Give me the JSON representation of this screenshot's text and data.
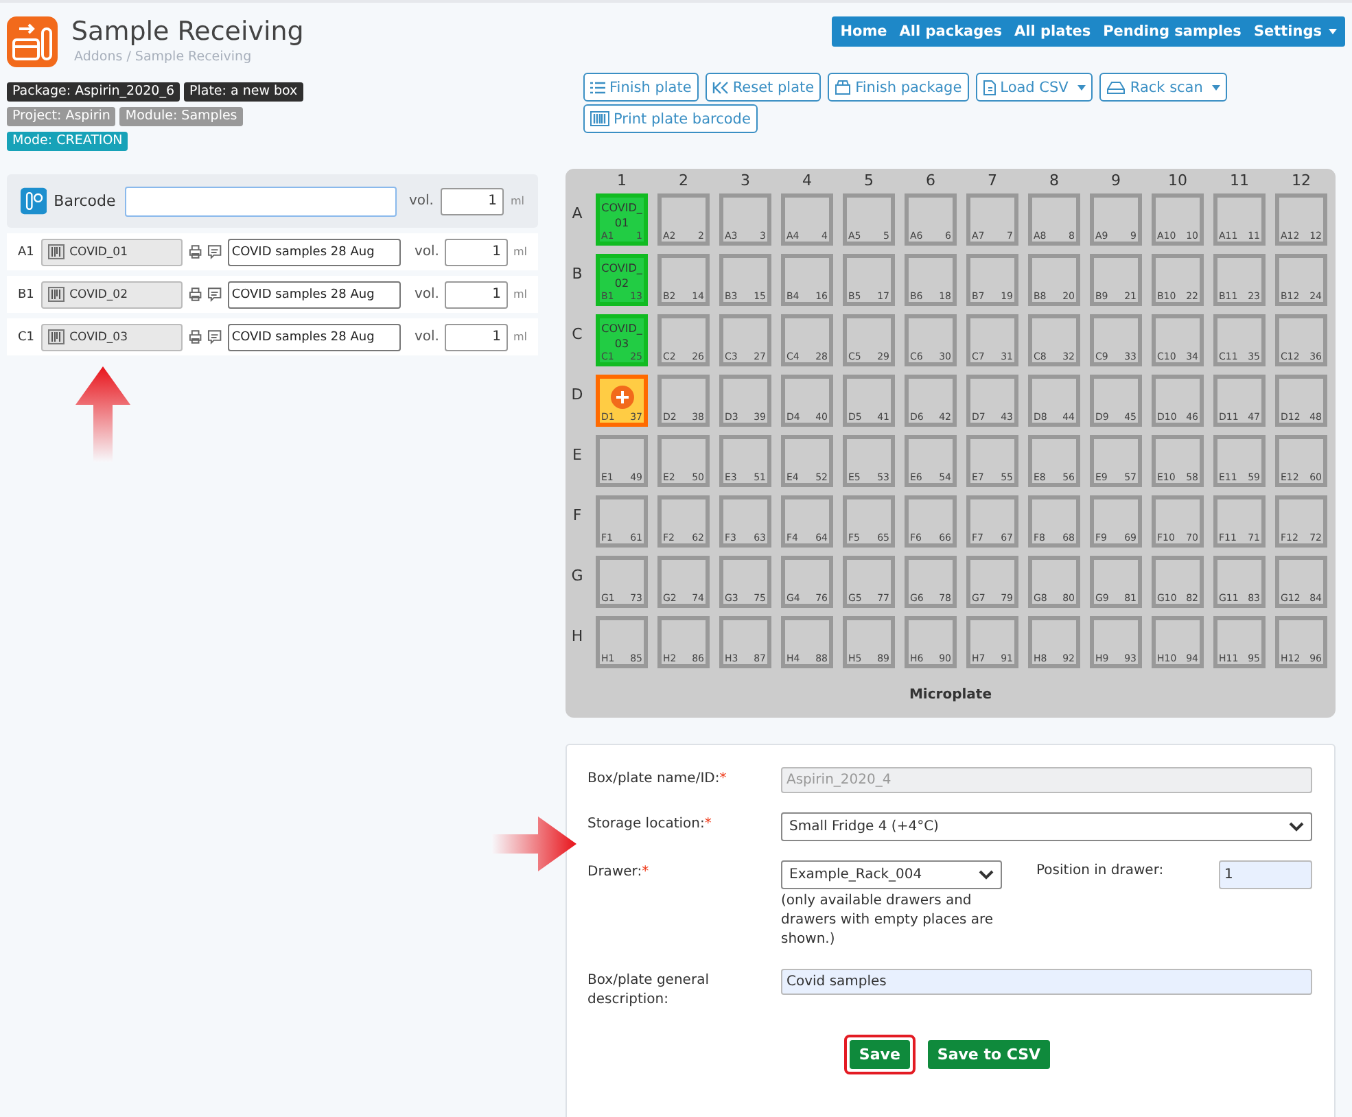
{
  "header": {
    "title": "Sample Receiving",
    "breadcrumb": "Addons / Sample Receiving"
  },
  "nav": [
    {
      "label": "Home",
      "dropdown": false
    },
    {
      "label": "All packages",
      "dropdown": false
    },
    {
      "label": "All plates",
      "dropdown": false
    },
    {
      "label": "Pending samples",
      "dropdown": false
    },
    {
      "label": "Settings",
      "dropdown": true
    }
  ],
  "badges": [
    [
      {
        "text": "Package: Aspirin_2020_6",
        "kind": "dark"
      },
      {
        "text": "Plate: a new box",
        "kind": "dark"
      }
    ],
    [
      {
        "text": "Project: Aspirin",
        "kind": "grey"
      },
      {
        "text": "Module: Samples",
        "kind": "grey"
      }
    ],
    [
      {
        "text": "Mode: CREATION",
        "kind": "info"
      }
    ]
  ],
  "toolbar": [
    [
      {
        "label": "Finish plate",
        "kind": "list",
        "dropdown": false
      },
      {
        "label": "Reset plate",
        "kind": "rewind",
        "dropdown": false
      },
      {
        "label": "Finish package",
        "kind": "box",
        "dropdown": false
      },
      {
        "label": "Load CSV",
        "kind": "file",
        "dropdown": true
      },
      {
        "label": "Rack scan",
        "kind": "scanner",
        "dropdown": true
      }
    ],
    [
      {
        "label": "Print plate barcode",
        "kind": "barcode",
        "dropdown": false
      }
    ]
  ],
  "barcode_entry": {
    "label": "Barcode",
    "vol_label": "vol.",
    "volume": "1",
    "unit": "ml"
  },
  "samples": [
    {
      "position": "A1",
      "barcode": "COVID_01",
      "description": "COVID samples 28 Aug",
      "vol_label": "vol.",
      "volume": "1",
      "unit": "ml"
    },
    {
      "position": "B1",
      "barcode": "COVID_02",
      "description": "COVID samples 28 Aug",
      "vol_label": "vol.",
      "volume": "1",
      "unit": "ml"
    },
    {
      "position": "C1",
      "barcode": "COVID_03",
      "description": "COVID samples 28 Aug",
      "vol_label": "vol.",
      "volume": "1",
      "unit": "ml"
    }
  ],
  "plate": {
    "title": "Microplate",
    "columns": [
      "1",
      "2",
      "3",
      "4",
      "5",
      "6",
      "7",
      "8",
      "9",
      "10",
      "11",
      "12"
    ],
    "rows": [
      {
        "label": "A",
        "wells": [
          {
            "label": "A1",
            "number": "1",
            "kind": "filled",
            "content": "COVID_01"
          },
          {
            "label": "A2",
            "number": "2",
            "kind": "empty"
          },
          {
            "label": "A3",
            "number": "3",
            "kind": "empty"
          },
          {
            "label": "A4",
            "number": "4",
            "kind": "empty"
          },
          {
            "label": "A5",
            "number": "5",
            "kind": "empty"
          },
          {
            "label": "A6",
            "number": "6",
            "kind": "empty"
          },
          {
            "label": "A7",
            "number": "7",
            "kind": "empty"
          },
          {
            "label": "A8",
            "number": "8",
            "kind": "empty"
          },
          {
            "label": "A9",
            "number": "9",
            "kind": "empty"
          },
          {
            "label": "A10",
            "number": "10",
            "kind": "empty"
          },
          {
            "label": "A11",
            "number": "11",
            "kind": "empty"
          },
          {
            "label": "A12",
            "number": "12",
            "kind": "empty"
          }
        ]
      },
      {
        "label": "B",
        "wells": [
          {
            "label": "B1",
            "number": "13",
            "kind": "filled",
            "content": "COVID_02"
          },
          {
            "label": "B2",
            "number": "14",
            "kind": "empty"
          },
          {
            "label": "B3",
            "number": "15",
            "kind": "empty"
          },
          {
            "label": "B4",
            "number": "16",
            "kind": "empty"
          },
          {
            "label": "B5",
            "number": "17",
            "kind": "empty"
          },
          {
            "label": "B6",
            "number": "18",
            "kind": "empty"
          },
          {
            "label": "B7",
            "number": "19",
            "kind": "empty"
          },
          {
            "label": "B8",
            "number": "20",
            "kind": "empty"
          },
          {
            "label": "B9",
            "number": "21",
            "kind": "empty"
          },
          {
            "label": "B10",
            "number": "22",
            "kind": "empty"
          },
          {
            "label": "B11",
            "number": "23",
            "kind": "empty"
          },
          {
            "label": "B12",
            "number": "24",
            "kind": "empty"
          }
        ]
      },
      {
        "label": "C",
        "wells": [
          {
            "label": "C1",
            "number": "25",
            "kind": "filled",
            "content": "COVID_03"
          },
          {
            "label": "C2",
            "number": "26",
            "kind": "empty"
          },
          {
            "label": "C3",
            "number": "27",
            "kind": "empty"
          },
          {
            "label": "C4",
            "number": "28",
            "kind": "empty"
          },
          {
            "label": "C5",
            "number": "29",
            "kind": "empty"
          },
          {
            "label": "C6",
            "number": "30",
            "kind": "empty"
          },
          {
            "label": "C7",
            "number": "31",
            "kind": "empty"
          },
          {
            "label": "C8",
            "number": "32",
            "kind": "empty"
          },
          {
            "label": "C9",
            "number": "33",
            "kind": "empty"
          },
          {
            "label": "C10",
            "number": "34",
            "kind": "empty"
          },
          {
            "label": "C11",
            "number": "35",
            "kind": "empty"
          },
          {
            "label": "C12",
            "number": "36",
            "kind": "empty"
          }
        ]
      },
      {
        "label": "D",
        "wells": [
          {
            "label": "D1",
            "number": "37",
            "kind": "current"
          },
          {
            "label": "D2",
            "number": "38",
            "kind": "empty"
          },
          {
            "label": "D3",
            "number": "39",
            "kind": "empty"
          },
          {
            "label": "D4",
            "number": "40",
            "kind": "empty"
          },
          {
            "label": "D5",
            "number": "41",
            "kind": "empty"
          },
          {
            "label": "D6",
            "number": "42",
            "kind": "empty"
          },
          {
            "label": "D7",
            "number": "43",
            "kind": "empty"
          },
          {
            "label": "D8",
            "number": "44",
            "kind": "empty"
          },
          {
            "label": "D9",
            "number": "45",
            "kind": "empty"
          },
          {
            "label": "D10",
            "number": "46",
            "kind": "empty"
          },
          {
            "label": "D11",
            "number": "47",
            "kind": "empty"
          },
          {
            "label": "D12",
            "number": "48",
            "kind": "empty"
          }
        ]
      },
      {
        "label": "E",
        "wells": [
          {
            "label": "E1",
            "number": "49",
            "kind": "empty"
          },
          {
            "label": "E2",
            "number": "50",
            "kind": "empty"
          },
          {
            "label": "E3",
            "number": "51",
            "kind": "empty"
          },
          {
            "label": "E4",
            "number": "52",
            "kind": "empty"
          },
          {
            "label": "E5",
            "number": "53",
            "kind": "empty"
          },
          {
            "label": "E6",
            "number": "54",
            "kind": "empty"
          },
          {
            "label": "E7",
            "number": "55",
            "kind": "empty"
          },
          {
            "label": "E8",
            "number": "56",
            "kind": "empty"
          },
          {
            "label": "E9",
            "number": "57",
            "kind": "empty"
          },
          {
            "label": "E10",
            "number": "58",
            "kind": "empty"
          },
          {
            "label": "E11",
            "number": "59",
            "kind": "empty"
          },
          {
            "label": "E12",
            "number": "60",
            "kind": "empty"
          }
        ]
      },
      {
        "label": "F",
        "wells": [
          {
            "label": "F1",
            "number": "61",
            "kind": "empty"
          },
          {
            "label": "F2",
            "number": "62",
            "kind": "empty"
          },
          {
            "label": "F3",
            "number": "63",
            "kind": "empty"
          },
          {
            "label": "F4",
            "number": "64",
            "kind": "empty"
          },
          {
            "label": "F5",
            "number": "65",
            "kind": "empty"
          },
          {
            "label": "F6",
            "number": "66",
            "kind": "empty"
          },
          {
            "label": "F7",
            "number": "67",
            "kind": "empty"
          },
          {
            "label": "F8",
            "number": "68",
            "kind": "empty"
          },
          {
            "label": "F9",
            "number": "69",
            "kind": "empty"
          },
          {
            "label": "F10",
            "number": "70",
            "kind": "empty"
          },
          {
            "label": "F11",
            "number": "71",
            "kind": "empty"
          },
          {
            "label": "F12",
            "number": "72",
            "kind": "empty"
          }
        ]
      },
      {
        "label": "G",
        "wells": [
          {
            "label": "G1",
            "number": "73",
            "kind": "empty"
          },
          {
            "label": "G2",
            "number": "74",
            "kind": "empty"
          },
          {
            "label": "G3",
            "number": "75",
            "kind": "empty"
          },
          {
            "label": "G4",
            "number": "76",
            "kind": "empty"
          },
          {
            "label": "G5",
            "number": "77",
            "kind": "empty"
          },
          {
            "label": "G6",
            "number": "78",
            "kind": "empty"
          },
          {
            "label": "G7",
            "number": "79",
            "kind": "empty"
          },
          {
            "label": "G8",
            "number": "80",
            "kind": "empty"
          },
          {
            "label": "G9",
            "number": "81",
            "kind": "empty"
          },
          {
            "label": "G10",
            "number": "82",
            "kind": "empty"
          },
          {
            "label": "G11",
            "number": "83",
            "kind": "empty"
          },
          {
            "label": "G12",
            "number": "84",
            "kind": "empty"
          }
        ]
      },
      {
        "label": "H",
        "wells": [
          {
            "label": "H1",
            "number": "85",
            "kind": "empty"
          },
          {
            "label": "H2",
            "number": "86",
            "kind": "empty"
          },
          {
            "label": "H3",
            "number": "87",
            "kind": "empty"
          },
          {
            "label": "H4",
            "number": "88",
            "kind": "empty"
          },
          {
            "label": "H5",
            "number": "89",
            "kind": "empty"
          },
          {
            "label": "H6",
            "number": "90",
            "kind": "empty"
          },
          {
            "label": "H7",
            "number": "91",
            "kind": "empty"
          },
          {
            "label": "H8",
            "number": "92",
            "kind": "empty"
          },
          {
            "label": "H9",
            "number": "93",
            "kind": "empty"
          },
          {
            "label": "H10",
            "number": "94",
            "kind": "empty"
          },
          {
            "label": "H11",
            "number": "95",
            "kind": "empty"
          },
          {
            "label": "H12",
            "number": "96",
            "kind": "empty"
          }
        ]
      }
    ]
  },
  "form": {
    "name": {
      "label": "Box/plate name/ID:",
      "required": true,
      "required_mark": "*",
      "value": "Aspirin_2020_4",
      "disabled": true
    },
    "storage": {
      "label": "Storage location:",
      "required": true,
      "required_mark": "*",
      "value": "Small Fridge 4 (+4°C)"
    },
    "drawer": {
      "label": "Drawer:",
      "required": true,
      "required_mark": "*",
      "value": "Example_Rack_004",
      "help": "(only available drawers and drawers with empty places are shown.)"
    },
    "position": {
      "label": "Position in drawer:",
      "value": "1"
    },
    "description": {
      "label": "Box/plate general description:",
      "value": "Covid samples"
    },
    "buttons": [
      {
        "label": "Save",
        "highlighted": true
      },
      {
        "label": "Save to CSV",
        "highlighted": false
      }
    ]
  }
}
